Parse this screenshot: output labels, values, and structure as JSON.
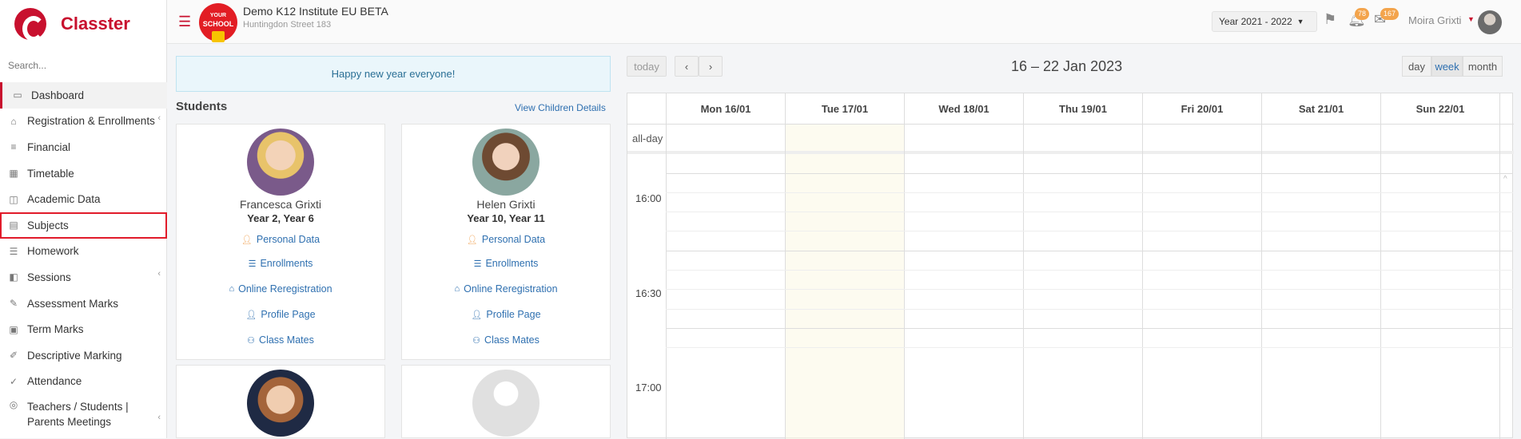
{
  "app": {
    "brand": "Classter",
    "search_placeholder": "Search..."
  },
  "sidebar": {
    "items": [
      {
        "label": "Dashboard",
        "icon": "laptop-icon"
      },
      {
        "label": "Registration & Enrollments",
        "icon": "institution-icon"
      },
      {
        "label": "Financial",
        "icon": "coins-icon"
      },
      {
        "label": "Timetable",
        "icon": "calendar-icon"
      },
      {
        "label": "Academic Data",
        "icon": "teacher-board-icon"
      },
      {
        "label": "Subjects",
        "icon": "book-icon"
      },
      {
        "label": "Homework",
        "icon": "list-icon"
      },
      {
        "label": "Sessions",
        "icon": "presentation-icon"
      },
      {
        "label": "Assessment Marks",
        "icon": "edit-icon"
      },
      {
        "label": "Term Marks",
        "icon": "stack-icon"
      },
      {
        "label": "Descriptive Marking",
        "icon": "pen-icon"
      },
      {
        "label": "Attendance",
        "icon": "user-check-icon"
      },
      {
        "label": "Teachers / Students | Parents Meetings",
        "icon": "meeting-icon"
      }
    ]
  },
  "header": {
    "badge_top": "YOUR",
    "badge_main": "SCHOOL",
    "institute_name": "Demo K12 Institute EU BETA",
    "institute_address": "Huntingdon Street 183",
    "year": "Year 2021 - 2022",
    "notifications_count": "78",
    "messages_count": "167",
    "user_name": "Moira Grixti"
  },
  "notice": "Happy new year everyone!",
  "students": {
    "title": "Students",
    "view_link": "View Children Details",
    "links": [
      "Personal Data",
      "Enrollments",
      "Online Reregistration",
      "Profile Page",
      "Class Mates"
    ],
    "cards": [
      {
        "name": "Francesca Grixti",
        "years": "Year 2, Year 6"
      },
      {
        "name": "Helen Grixti",
        "years": "Year 10, Year 11"
      }
    ]
  },
  "calendar": {
    "today": "today",
    "prev": "‹",
    "next": "›",
    "title": "16 – 22 Jan 2023",
    "views": [
      "day",
      "week",
      "month"
    ],
    "days": [
      "Mon 16/01",
      "Tue 17/01",
      "Wed 18/01",
      "Thu 19/01",
      "Fri 20/01",
      "Sat 21/01",
      "Sun 22/01"
    ],
    "allday": "all-day",
    "times": [
      "16:00",
      "16:30",
      "17:00"
    ]
  },
  "colors": {
    "brand": "#c8102e",
    "link": "#2f70b0",
    "notice_bg": "#eaf6fb",
    "badge": "#f3a44c"
  }
}
